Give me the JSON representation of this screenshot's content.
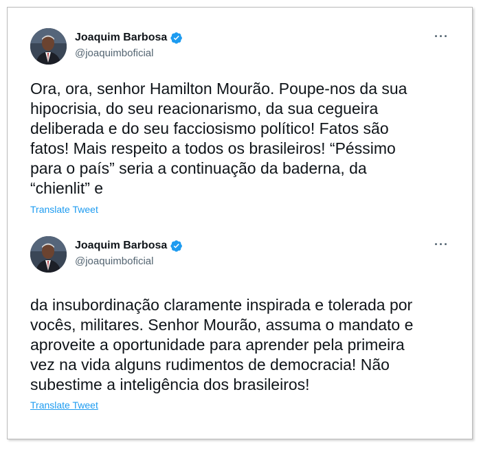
{
  "tweets": [
    {
      "author": {
        "name": "Joaquim Barbosa",
        "handle": "@joaquimboficial",
        "verified": true,
        "avatar_icon": "person-portrait-icon"
      },
      "more_icon": "more-horizontal-icon",
      "more_label": "···",
      "text": "Ora, ora, senhor Hamilton Mourão. Poupe-nos da sua\nhipocrisia, do seu reacionarismo, da sua cegueira\ndeliberada e do seu facciosismo político! Fatos são\nfatos! Mais respeito a todos os brasileiros! “Péssimo\npara o país” seria a continuação da baderna, da\n“chienlit” e",
      "translate_label": "Translate Tweet"
    },
    {
      "author": {
        "name": "Joaquim Barbosa",
        "handle": "@joaquimboficial",
        "verified": true,
        "avatar_icon": "person-portrait-icon"
      },
      "more_icon": "more-horizontal-icon",
      "more_label": "···",
      "text": "da insubordinação claramente inspirada e tolerada por\nvocês, militares. Senhor Mourão, assuma o mandato e\naproveite a oportunidade para aprender pela primeira\nvez na vida alguns rudimentos de democracia! Não\nsubestime a inteligência dos brasileiros!",
      "translate_label": "Translate Tweet"
    }
  ],
  "colors": {
    "accent": "#1d9bf0",
    "text": "#0f1419",
    "secondary": "#536471"
  }
}
